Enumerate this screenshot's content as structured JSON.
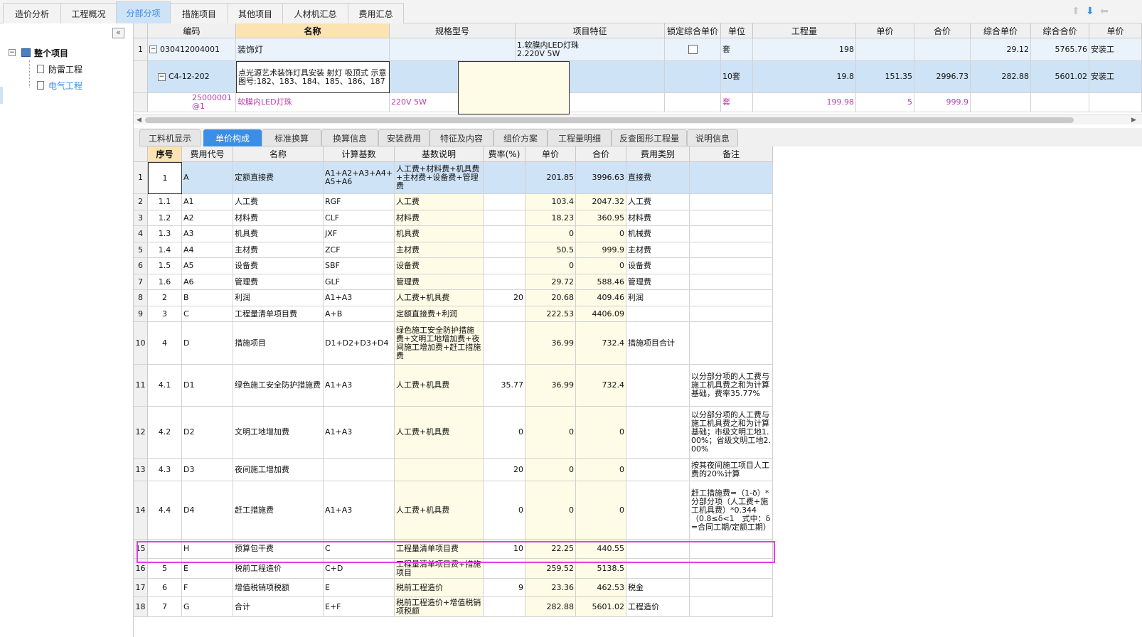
{
  "top_tabs": [
    "造价分析",
    "工程概况",
    "分部分项",
    "措施项目",
    "其他项目",
    "人材机汇总",
    "费用汇总"
  ],
  "active_tab": "分部分项",
  "sidebar": {
    "collapse": "«",
    "root": "整个项目",
    "children": [
      "防雷工程",
      "电气工程"
    ]
  },
  "upper": {
    "headers": [
      "编码",
      "名称",
      "规格型号",
      "项目特征",
      "锁定综合单价",
      "单位",
      "工程量",
      "单价",
      "合价",
      "综合单价",
      "综合合价",
      "单价"
    ],
    "rows": [
      {
        "num": "1",
        "expander": "−",
        "code": "030412004001",
        "name": "装饰灯",
        "spec": "",
        "feature": "1.软膜内LED灯珠\n2.220V 5W",
        "unit": "套",
        "qty": "198",
        "price": "",
        "total": "",
        "cprice": "29.12",
        "ctotal": "5765.76",
        "extra": "安装工"
      },
      {
        "num": "",
        "expander": "−",
        "code": "C4-12-202",
        "name": "点光源艺术装饰灯具安装 射灯 吸顶式 示意图号:182、183、184、185、186、187",
        "spec": "",
        "feature": "",
        "unit": "10套",
        "qty": "19.8",
        "price": "151.35",
        "total": "2996.73",
        "cprice": "282.88",
        "ctotal": "5601.02",
        "extra": "安装工"
      },
      {
        "num": "",
        "code": "25000001@1",
        "name": "软膜内LED灯珠",
        "spec": "220V 5W",
        "feature": "",
        "unit": "套",
        "qty": "199.98",
        "price": "5",
        "total": "999.9",
        "cprice": "",
        "ctotal": "",
        "extra": ""
      }
    ]
  },
  "lower_tabs": [
    "工料机显示",
    "单价构成",
    "标准换算",
    "换算信息",
    "安装费用",
    "特征及内容",
    "组价方案",
    "工程量明细",
    "反查图形工程量",
    "说明信息"
  ],
  "active_lower_tab": "单价构成",
  "lower": {
    "headers": [
      "序号",
      "费用代号",
      "名称",
      "计算基数",
      "基数说明",
      "费率(%)",
      "单价",
      "合价",
      "费用类别",
      "备注"
    ],
    "rows": [
      {
        "n": "1",
        "seq": "1",
        "code": "A",
        "name": "定额直接费",
        "base": "A1+A2+A3+A4+A5+A6",
        "desc": "人工费+材料费+机具费+主材费+设备费+管理费",
        "rate": "",
        "price": "201.85",
        "total": "3996.63",
        "cat": "直接费",
        "note": ""
      },
      {
        "n": "2",
        "seq": "1.1",
        "code": "A1",
        "name": "人工费",
        "base": "RGF",
        "desc": "人工费",
        "rate": "",
        "price": "103.4",
        "total": "2047.32",
        "cat": "人工费",
        "note": ""
      },
      {
        "n": "3",
        "seq": "1.2",
        "code": "A2",
        "name": "材料费",
        "base": "CLF",
        "desc": "材料费",
        "rate": "",
        "price": "18.23",
        "total": "360.95",
        "cat": "材料费",
        "note": ""
      },
      {
        "n": "4",
        "seq": "1.3",
        "code": "A3",
        "name": "机具费",
        "base": "JXF",
        "desc": "机具费",
        "rate": "",
        "price": "0",
        "total": "0",
        "cat": "机械费",
        "note": ""
      },
      {
        "n": "5",
        "seq": "1.4",
        "code": "A4",
        "name": "主材费",
        "base": "ZCF",
        "desc": "主材费",
        "rate": "",
        "price": "50.5",
        "total": "999.9",
        "cat": "主材费",
        "note": ""
      },
      {
        "n": "6",
        "seq": "1.5",
        "code": "A5",
        "name": "设备费",
        "base": "SBF",
        "desc": "设备费",
        "rate": "",
        "price": "0",
        "total": "0",
        "cat": "设备费",
        "note": ""
      },
      {
        "n": "7",
        "seq": "1.6",
        "code": "A6",
        "name": "管理费",
        "base": "GLF",
        "desc": "管理费",
        "rate": "",
        "price": "29.72",
        "total": "588.46",
        "cat": "管理费",
        "note": ""
      },
      {
        "n": "8",
        "seq": "2",
        "code": "B",
        "name": "利润",
        "base": "A1+A3",
        "desc": "人工费+机具费",
        "rate": "20",
        "price": "20.68",
        "total": "409.46",
        "cat": "利润",
        "note": ""
      },
      {
        "n": "9",
        "seq": "3",
        "code": "C",
        "name": "工程量清单项目费",
        "base": "A+B",
        "desc": "定额直接费+利润",
        "rate": "",
        "price": "222.53",
        "total": "4406.09",
        "cat": "",
        "note": ""
      },
      {
        "n": "10",
        "seq": "4",
        "code": "D",
        "name": "措施项目",
        "base": "D1+D2+D3+D4",
        "desc": "绿色施工安全防护措施费+文明工地增加费+夜间施工增加费+赶工措施费",
        "rate": "",
        "price": "36.99",
        "total": "732.4",
        "cat": "措施项目合计",
        "note": ""
      },
      {
        "n": "11",
        "seq": "4.1",
        "code": "D1",
        "name": "绿色施工安全防护措施费",
        "base": "A1+A3",
        "desc": "人工费+机具费",
        "rate": "35.77",
        "price": "36.99",
        "total": "732.4",
        "cat": "",
        "note": "以分部分项的人工费与施工机具费之和为计算基础，费率35.77%"
      },
      {
        "n": "12",
        "seq": "4.2",
        "code": "D2",
        "name": "文明工地增加费",
        "base": "A1+A3",
        "desc": "人工费+机具费",
        "rate": "0",
        "price": "0",
        "total": "0",
        "cat": "",
        "note": "以分部分项的人工费与施工机具费之和为计算基础；市级文明工地1.00%；省级文明工地2.00%"
      },
      {
        "n": "13",
        "seq": "4.3",
        "code": "D3",
        "name": "夜间施工增加费",
        "base": "",
        "desc": "",
        "rate": "20",
        "price": "0",
        "total": "0",
        "cat": "",
        "note": "按其夜间施工项目人工费的20%计算"
      },
      {
        "n": "14",
        "seq": "4.4",
        "code": "D4",
        "name": "赶工措施费",
        "base": "A1+A3",
        "desc": "人工费+机具费",
        "rate": "0",
        "price": "0",
        "total": "0",
        "cat": "",
        "note": "赶工措施费=（1-δ）*分部分项（人工费+施工机具费）*0.344（0.8≤δ<1　式中：δ=合同工期/定额工期）"
      },
      {
        "n": "15",
        "seq": "",
        "code": "H",
        "name": "预算包干费",
        "base": "C",
        "desc": "工程量清单项目费",
        "rate": "10",
        "price": "22.25",
        "total": "440.55",
        "cat": "",
        "note": ""
      },
      {
        "n": "16",
        "seq": "5",
        "code": "E",
        "name": "税前工程造价",
        "base": "C+D",
        "desc": "工程量清单项目费+措施项目",
        "rate": "",
        "price": "259.52",
        "total": "5138.5",
        "cat": "",
        "note": ""
      },
      {
        "n": "17",
        "seq": "6",
        "code": "F",
        "name": "增值税销项税额",
        "base": "E",
        "desc": "税前工程造价",
        "rate": "9",
        "price": "23.36",
        "total": "462.53",
        "cat": "税金",
        "note": ""
      },
      {
        "n": "18",
        "seq": "7",
        "code": "G",
        "name": "合计",
        "base": "E+F",
        "desc": "税前工程造价+增值税销项税额",
        "rate": "",
        "price": "282.88",
        "total": "5601.02",
        "cat": "工程造价",
        "note": ""
      }
    ]
  },
  "colors": {
    "accent": "#3a8ee6",
    "selected_row": "#cfe3f7",
    "highlight_border": "#e33fe0",
    "pink_text": "#c03aa8"
  }
}
